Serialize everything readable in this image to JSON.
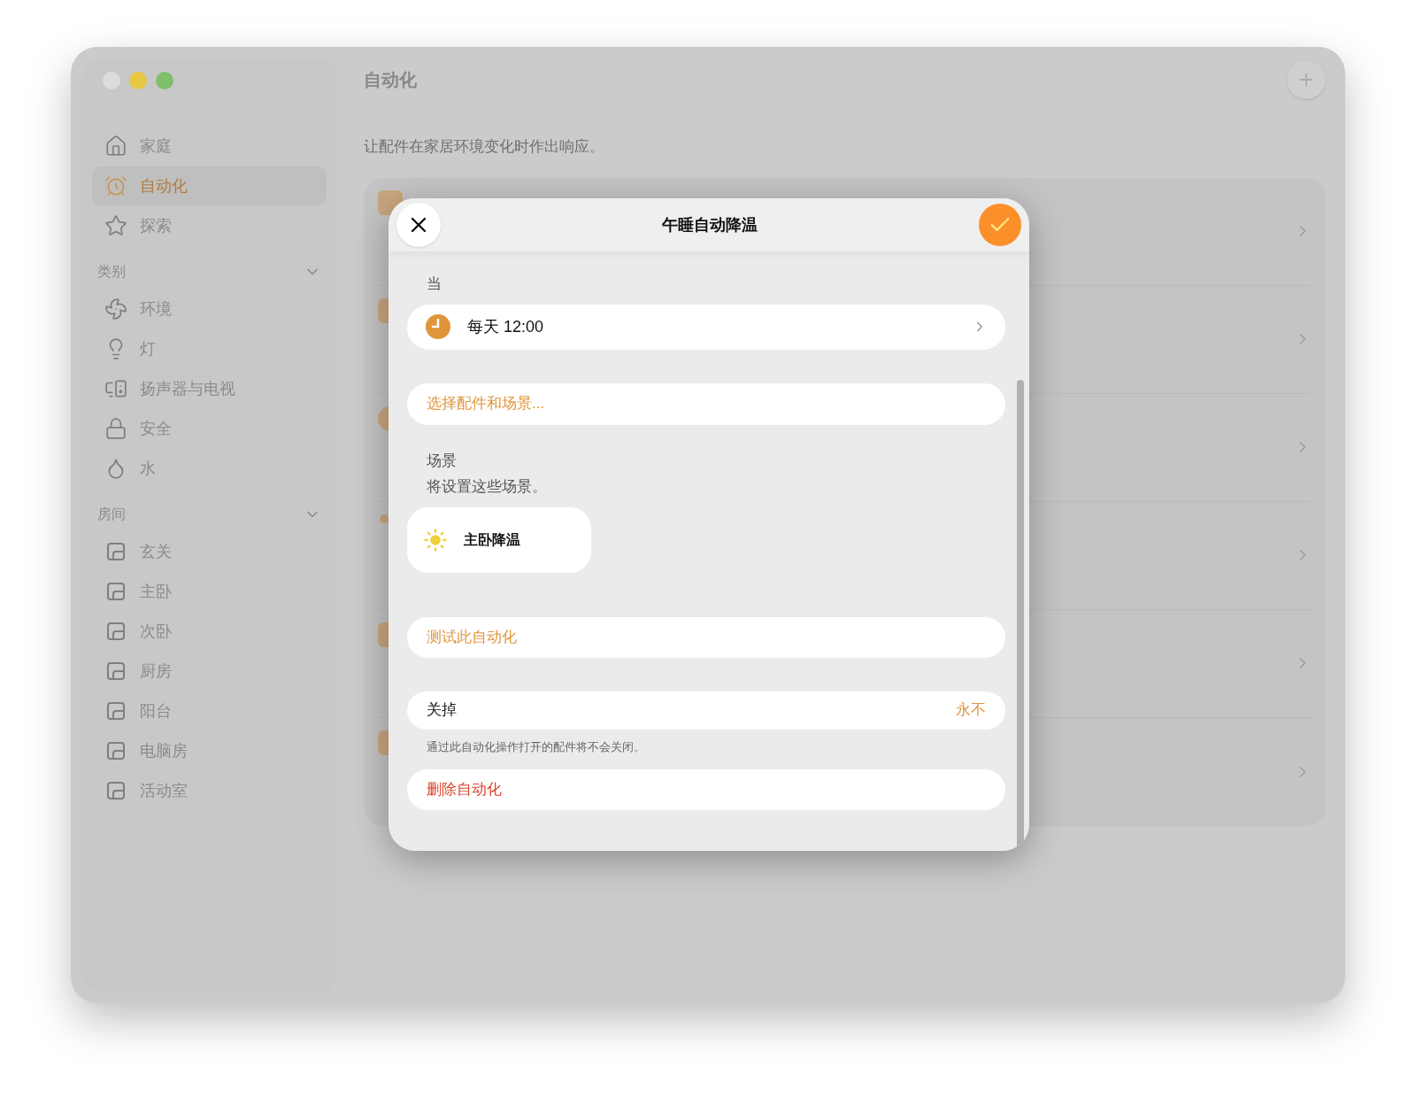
{
  "sidebar": {
    "items": [
      {
        "label": "家庭",
        "selected": false
      },
      {
        "label": "自动化",
        "selected": true
      },
      {
        "label": "探索",
        "selected": false
      }
    ],
    "sections": [
      {
        "title": "类别",
        "expanded": true,
        "kind": "categories",
        "items": [
          {
            "label": "环境"
          },
          {
            "label": "灯"
          },
          {
            "label": "扬声器与电视"
          },
          {
            "label": "安全"
          },
          {
            "label": "水"
          }
        ]
      },
      {
        "title": "房间",
        "expanded": true,
        "kind": "rooms",
        "items": [
          {
            "label": "玄关"
          },
          {
            "label": "主卧"
          },
          {
            "label": "次卧"
          },
          {
            "label": "厨房"
          },
          {
            "label": "阳台"
          },
          {
            "label": "电脑房"
          },
          {
            "label": "活动室"
          }
        ]
      }
    ]
  },
  "main": {
    "title": "自动化",
    "subtitle": "让配件在家居环境变化时作出响应。",
    "rows": [
      {
        "kind": "square"
      },
      {
        "kind": "square"
      },
      {
        "kind": "circle"
      },
      {
        "kind": "dot"
      },
      {
        "kind": "square"
      },
      {
        "kind": "square"
      }
    ]
  },
  "dialog": {
    "title": "午睡自动降温",
    "trigger": {
      "label": "当",
      "text": "每天 12:00"
    },
    "select_link": "选择配件和场景...",
    "scenes": {
      "title": "场景",
      "subtitle": "将设置这些场景。",
      "items": [
        {
          "name": "主卧降温"
        }
      ]
    },
    "test_button": "测试此自动化",
    "turn_off": {
      "label": "关掉",
      "value": "永不",
      "note": "通过此自动化操作打开的配件将不会关闭。"
    },
    "delete_button": "删除自动化"
  }
}
